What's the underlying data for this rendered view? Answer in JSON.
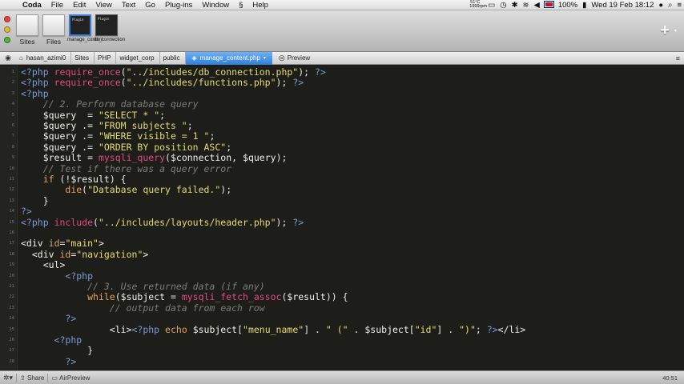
{
  "menubar": {
    "app_name": "Coda",
    "items": [
      "File",
      "Edit",
      "View",
      "Text",
      "Go",
      "Plug-ins",
      "Window",
      "Help"
    ],
    "weather_temp": "51°C",
    "weather_sub": "1999rpm",
    "battery": "100%",
    "clock": "Wed 19 Feb  18:12"
  },
  "toolbar": {
    "sites_label": "Sites",
    "files_label": "Files",
    "tab1_label": "manage_content",
    "tab2_label": "db_connection",
    "tab1_thumb_text": "Plugin",
    "tab2_thumb_text": "Plugin"
  },
  "pathbar": {
    "crumbs": [
      "hasan_azimi0",
      "Sites",
      "PHP",
      "widget_corp",
      "public"
    ],
    "current_file": "manage_content.php",
    "preview_label": "Preview"
  },
  "editor": {
    "line_numbers": [
      "1",
      "2",
      "3",
      "4",
      "5",
      "6",
      "7",
      "8",
      "9",
      "10",
      "11",
      "12",
      "13",
      "14",
      "15",
      "16",
      "17",
      "18",
      "19",
      "20",
      "21",
      "22",
      "23",
      "24",
      "25",
      "26",
      "27",
      "28"
    ]
  },
  "statusbar": {
    "share_label": "Share",
    "airpreview_label": "AirPreview",
    "cursor_pos": "40:51"
  },
  "colors": {
    "editor_bg": "#1d1e1a",
    "php_marker": "#7b9ad9",
    "function": "#e04a86",
    "string": "#e6db74",
    "comment": "#7e7e78",
    "active_tab": "#2f7fd9"
  }
}
